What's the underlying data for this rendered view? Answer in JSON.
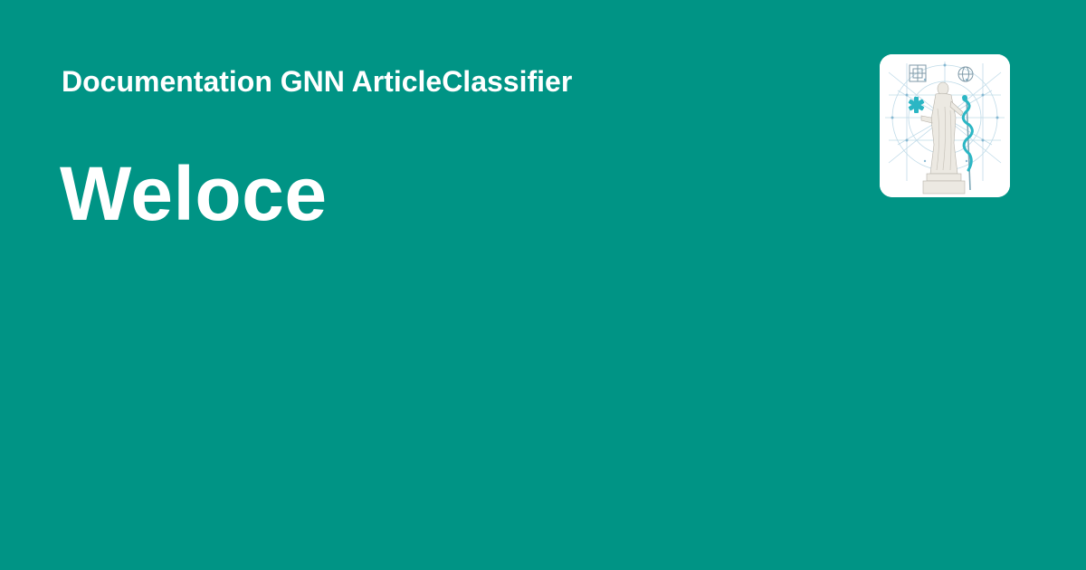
{
  "header": {
    "site_name": "Documentation GNN ArticleClassifier"
  },
  "main": {
    "title": "Weloce"
  },
  "logo": {
    "icon": "statue-network-logo-icon",
    "accent": "#2bb6c4"
  },
  "colors": {
    "background": "#009485",
    "text": "#ffffff"
  }
}
